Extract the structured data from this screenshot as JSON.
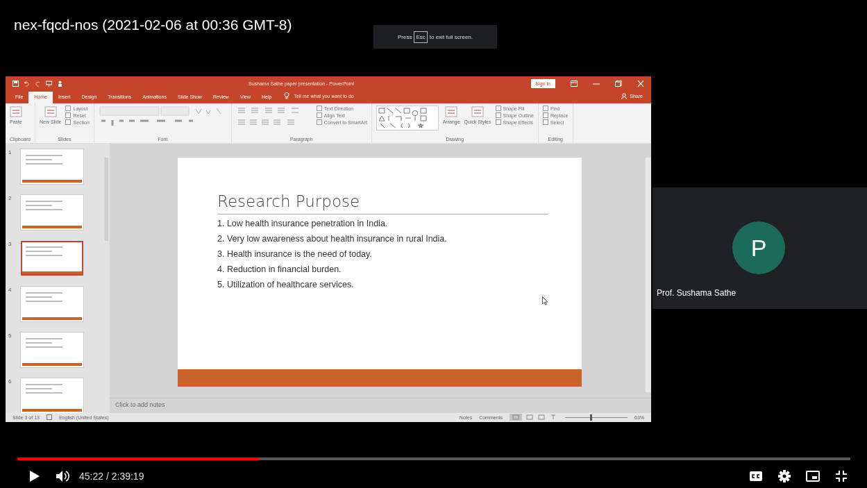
{
  "video": {
    "title": "nex-fqcd-nos (2021-02-06 at 00:36 GMT-8)",
    "fullscreen_hint": {
      "before": "Press",
      "key": "Esc",
      "after": "to exit full screen."
    }
  },
  "powerpoint": {
    "title": "Sushama Sathe paper presentation  -  PowerPoint",
    "sign_in": "Sign in",
    "tabs": [
      {
        "label": "File",
        "selected": false
      },
      {
        "label": "Home",
        "selected": true
      },
      {
        "label": "Insert",
        "selected": false
      },
      {
        "label": "Design",
        "selected": false
      },
      {
        "label": "Transitions",
        "selected": false
      },
      {
        "label": "Animations",
        "selected": false
      },
      {
        "label": "Slide Show",
        "selected": false
      },
      {
        "label": "Review",
        "selected": false
      },
      {
        "label": "View",
        "selected": false
      },
      {
        "label": "Help",
        "selected": false
      }
    ],
    "tell_me": "Tell me what you want to do",
    "share": "Share",
    "ribbon": [
      {
        "kind": "clipboard",
        "label": "Clipboard",
        "items": [
          {
            "label": "Paste",
            "kind": "big"
          }
        ]
      },
      {
        "kind": "slides",
        "label": "Slides",
        "items": [
          {
            "label": "New Slide",
            "kind": "big"
          },
          {
            "label": "Layout",
            "kind": "small"
          },
          {
            "label": "Reset",
            "kind": "small"
          },
          {
            "label": "Section",
            "kind": "small"
          }
        ]
      },
      {
        "kind": "font",
        "label": "Font"
      },
      {
        "kind": "paragraph",
        "label": "Paragraph",
        "items": [
          {
            "label": "Text Direction",
            "kind": "small"
          },
          {
            "label": "Align Text",
            "kind": "small"
          },
          {
            "label": "Convert to SmartArt",
            "kind": "small"
          }
        ]
      },
      {
        "kind": "drawing",
        "label": "Drawing",
        "items": [
          {
            "label": "Arrange",
            "kind": "big"
          },
          {
            "label": "Quick Styles",
            "kind": "big"
          },
          {
            "label": "Shape Fill",
            "kind": "small"
          },
          {
            "label": "Shape Outline",
            "kind": "small"
          },
          {
            "label": "Shape Effects",
            "kind": "small"
          }
        ]
      },
      {
        "kind": "editing",
        "label": "Editing",
        "items": [
          {
            "label": "Find",
            "kind": "small"
          },
          {
            "label": "Replace",
            "kind": "small"
          },
          {
            "label": "Select",
            "kind": "small"
          }
        ]
      }
    ],
    "thumbnails": [
      {
        "number": "1",
        "selected": false
      },
      {
        "number": "2",
        "selected": false
      },
      {
        "number": "3",
        "selected": true
      },
      {
        "number": "4",
        "selected": false
      },
      {
        "number": "5",
        "selected": false
      },
      {
        "number": "6",
        "selected": false
      }
    ],
    "slide": {
      "title": "Research Purpose",
      "points": [
        "1. Low health insurance penetration in India.",
        "2. Very low awareness about health insurance in rural India.",
        "3. Health insurance is the need of today.",
        "4. Reduction in financial burden.",
        "5. Utilization of healthcare services."
      ]
    },
    "notes_placeholder": "Click to add notes",
    "status": {
      "slide": "Slide 3 of 13",
      "language": "English (United States)",
      "notes": "Notes",
      "comments": "Comments",
      "zoom": "63%",
      "zoom_slider": {
        "level": 0.4
      }
    }
  },
  "participant": {
    "initial": "P",
    "name": "Prof. Sushama Sathe"
  },
  "player": {
    "progress": {
      "level": 0.29
    },
    "time": "45:22 / 2:39:19"
  }
}
